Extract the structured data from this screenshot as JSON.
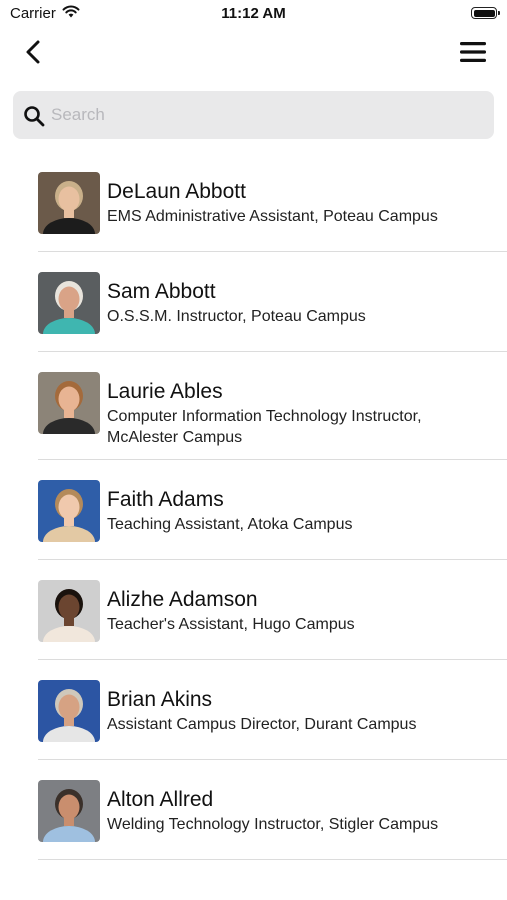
{
  "status_bar": {
    "carrier": "Carrier",
    "time": "11:12 AM",
    "icons": [
      "wifi-icon",
      "battery-icon"
    ]
  },
  "nav": {
    "icons": [
      "chevron-left-icon",
      "hamburger-menu-icon"
    ]
  },
  "search": {
    "placeholder": "Search",
    "value": "",
    "icon": "search-icon"
  },
  "directory": [
    {
      "name": "DeLaun Abbott",
      "title": "EMS Administrative Assistant, Poteau Campus",
      "photo": {
        "bg": "#6b5a4a",
        "skin": "#e8c0a0",
        "hair": "#c9b08a",
        "shirt": "#1c1c1c"
      }
    },
    {
      "name": "Sam Abbott",
      "title": "O.S.S.M. Instructor, Poteau Campus",
      "photo": {
        "bg": "#5a5e60",
        "skin": "#d9a387",
        "hair": "#e8e4dc",
        "shirt": "#3fb6b0"
      }
    },
    {
      "name": "Laurie Ables",
      "title": "Computer Information Technology Instructor, McAlester Campus",
      "photo": {
        "bg": "#8c8478",
        "skin": "#e8b493",
        "hair": "#a46a3b",
        "shirt": "#2a2a2a"
      }
    },
    {
      "name": "Faith Adams",
      "title": "Teaching Assistant, Atoka Campus",
      "photo": {
        "bg": "#2f5ea8",
        "skin": "#f0c9ad",
        "hair": "#b48a5a",
        "shirt": "#e3c9a4"
      }
    },
    {
      "name": "Alizhe Adamson",
      "title": "Teacher's Assistant, Hugo Campus",
      "photo": {
        "bg": "#cfcfcf",
        "skin": "#6b4530",
        "hair": "#1a120d",
        "shirt": "#f1e7dc"
      }
    },
    {
      "name": "Brian Akins",
      "title": "Assistant Campus Director, Durant Campus",
      "photo": {
        "bg": "#2c55a3",
        "skin": "#d6a283",
        "hair": "#cfc8bb",
        "shirt": "#e6e6e6"
      }
    },
    {
      "name": "Alton Allred",
      "title": "Welding Technology Instructor, Stigler Campus",
      "photo": {
        "bg": "#7d7f83",
        "skin": "#c98e6e",
        "hair": "#3a302a",
        "shirt": "#9fc0e0"
      }
    }
  ]
}
